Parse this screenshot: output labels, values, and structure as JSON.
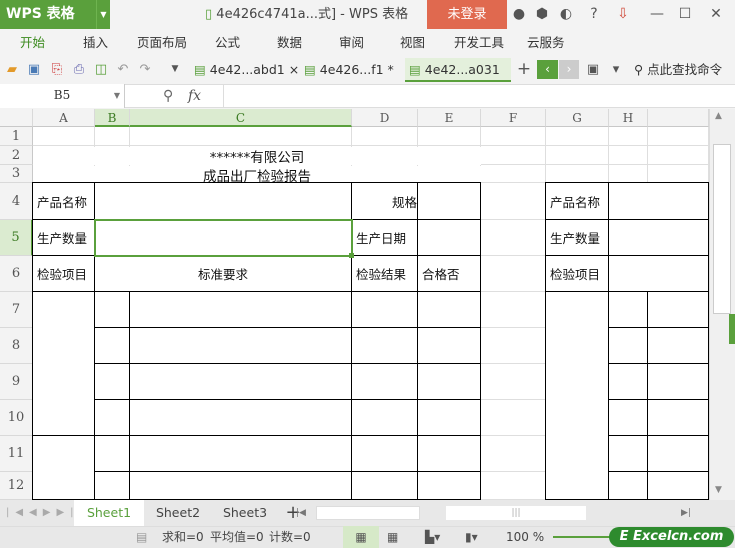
{
  "app": {
    "logo": "WPS 表格",
    "window_title": "4e426c4741a...式] - WPS 表格",
    "login": "未登录",
    "icons": [
      "skin-icon",
      "settings-icon",
      "theme-icon",
      "help-icon",
      "download-icon",
      "minimize-icon",
      "maximize-icon",
      "close-icon"
    ]
  },
  "menu": [
    "开始",
    "插入",
    "页面布局",
    "公式",
    "数据",
    "审阅",
    "视图",
    "开发工具",
    "云服务"
  ],
  "doc_tabs": [
    {
      "label": "4e42...abd1",
      "active": false
    },
    {
      "label": "4e426...f1 *",
      "active": false
    },
    {
      "label": "4e42...a031",
      "active": true
    }
  ],
  "search_label": "点此查找命令",
  "formula": {
    "name_box": "B5",
    "fx": "fx",
    "value": ""
  },
  "columns": [
    "A",
    "B",
    "C",
    "D",
    "E",
    "F",
    "G",
    "H"
  ],
  "rows": [
    "1",
    "2",
    "3",
    "4",
    "5",
    "6",
    "7",
    "8",
    "9",
    "10",
    "11",
    "12"
  ],
  "selected_cell": "B5",
  "cells": {
    "company": "******有限公司",
    "report_title": "成品出厂检验报告",
    "A4": "产品名称",
    "D4": "规格",
    "A5": "生产数量",
    "D5": "生产日期",
    "A6": "检验项目",
    "B6": "标准要求",
    "D6": "检验结果",
    "E6": "合格否",
    "G4": "产品名称",
    "G5": "生产数量",
    "G6": "检验项目"
  },
  "sheets": [
    {
      "label": "Sheet1",
      "active": true
    },
    {
      "label": "Sheet2",
      "active": false
    },
    {
      "label": "Sheet3",
      "active": false
    }
  ],
  "status": {
    "sum": "求和=0",
    "avg": "平均值=0",
    "count": "计数=0",
    "zoom": "100 %"
  },
  "watermark": "Excelcn.com",
  "colors": {
    "accent": "#5aa03c",
    "login": "#e0694f"
  }
}
